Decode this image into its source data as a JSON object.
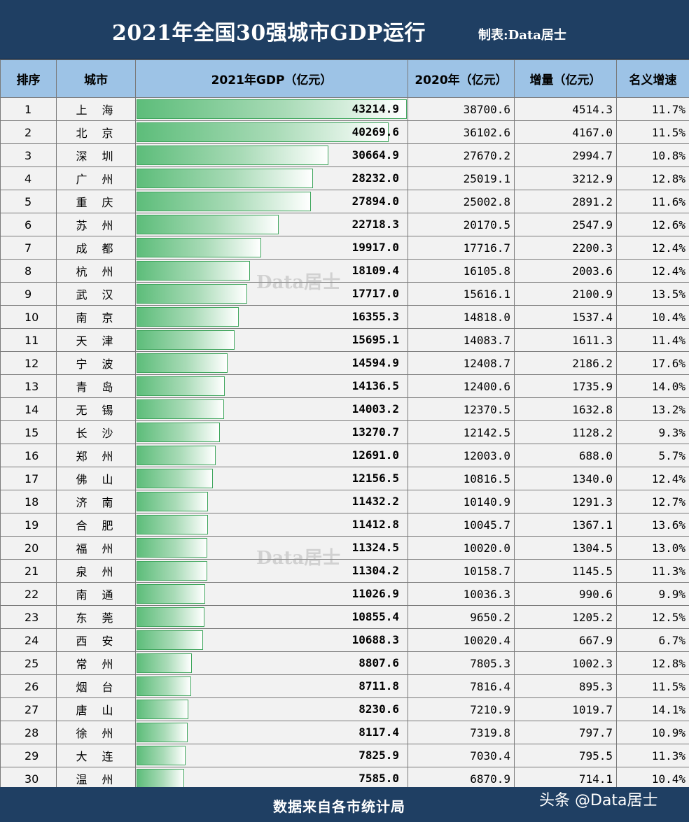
{
  "header": {
    "title": "2021年全国30强城市GDP运行",
    "subtitle": "制表:Data居士"
  },
  "columns": [
    "排序",
    "城市",
    "2021年GDP（亿元）",
    "2020年（亿元）",
    "增量（亿元）",
    "名义增速"
  ],
  "chart_data": {
    "type": "table",
    "title": "2021年全国30强城市GDP运行",
    "bar_max": 43214.9,
    "rows": [
      {
        "rank": "1",
        "city": "上 海",
        "gdp2021": "43214.9",
        "gdp2020": "38700.6",
        "increase": "4514.3",
        "growth": "11.7%"
      },
      {
        "rank": "2",
        "city": "北 京",
        "gdp2021": "40269.6",
        "gdp2020": "36102.6",
        "increase": "4167.0",
        "growth": "11.5%"
      },
      {
        "rank": "3",
        "city": "深 圳",
        "gdp2021": "30664.9",
        "gdp2020": "27670.2",
        "increase": "2994.7",
        "growth": "10.8%"
      },
      {
        "rank": "4",
        "city": "广 州",
        "gdp2021": "28232.0",
        "gdp2020": "25019.1",
        "increase": "3212.9",
        "growth": "12.8%"
      },
      {
        "rank": "5",
        "city": "重 庆",
        "gdp2021": "27894.0",
        "gdp2020": "25002.8",
        "increase": "2891.2",
        "growth": "11.6%"
      },
      {
        "rank": "6",
        "city": "苏 州",
        "gdp2021": "22718.3",
        "gdp2020": "20170.5",
        "increase": "2547.9",
        "growth": "12.6%"
      },
      {
        "rank": "7",
        "city": "成 都",
        "gdp2021": "19917.0",
        "gdp2020": "17716.7",
        "increase": "2200.3",
        "growth": "12.4%"
      },
      {
        "rank": "8",
        "city": "杭 州",
        "gdp2021": "18109.4",
        "gdp2020": "16105.8",
        "increase": "2003.6",
        "growth": "12.4%"
      },
      {
        "rank": "9",
        "city": "武 汉",
        "gdp2021": "17717.0",
        "gdp2020": "15616.1",
        "increase": "2100.9",
        "growth": "13.5%"
      },
      {
        "rank": "10",
        "city": "南 京",
        "gdp2021": "16355.3",
        "gdp2020": "14818.0",
        "increase": "1537.4",
        "growth": "10.4%"
      },
      {
        "rank": "11",
        "city": "天 津",
        "gdp2021": "15695.1",
        "gdp2020": "14083.7",
        "increase": "1611.3",
        "growth": "11.4%"
      },
      {
        "rank": "12",
        "city": "宁 波",
        "gdp2021": "14594.9",
        "gdp2020": "12408.7",
        "increase": "2186.2",
        "growth": "17.6%"
      },
      {
        "rank": "13",
        "city": "青 岛",
        "gdp2021": "14136.5",
        "gdp2020": "12400.6",
        "increase": "1735.9",
        "growth": "14.0%"
      },
      {
        "rank": "14",
        "city": "无 锡",
        "gdp2021": "14003.2",
        "gdp2020": "12370.5",
        "increase": "1632.8",
        "growth": "13.2%"
      },
      {
        "rank": "15",
        "city": "长 沙",
        "gdp2021": "13270.7",
        "gdp2020": "12142.5",
        "increase": "1128.2",
        "growth": "9.3%"
      },
      {
        "rank": "16",
        "city": "郑 州",
        "gdp2021": "12691.0",
        "gdp2020": "12003.0",
        "increase": "688.0",
        "growth": "5.7%"
      },
      {
        "rank": "17",
        "city": "佛 山",
        "gdp2021": "12156.5",
        "gdp2020": "10816.5",
        "increase": "1340.0",
        "growth": "12.4%"
      },
      {
        "rank": "18",
        "city": "济 南",
        "gdp2021": "11432.2",
        "gdp2020": "10140.9",
        "increase": "1291.3",
        "growth": "12.7%"
      },
      {
        "rank": "19",
        "city": "合 肥",
        "gdp2021": "11412.8",
        "gdp2020": "10045.7",
        "increase": "1367.1",
        "growth": "13.6%"
      },
      {
        "rank": "20",
        "city": "福 州",
        "gdp2021": "11324.5",
        "gdp2020": "10020.0",
        "increase": "1304.5",
        "growth": "13.0%"
      },
      {
        "rank": "21",
        "city": "泉 州",
        "gdp2021": "11304.2",
        "gdp2020": "10158.7",
        "increase": "1145.5",
        "growth": "11.3%"
      },
      {
        "rank": "22",
        "city": "南 通",
        "gdp2021": "11026.9",
        "gdp2020": "10036.3",
        "increase": "990.6",
        "growth": "9.9%"
      },
      {
        "rank": "23",
        "city": "东 莞",
        "gdp2021": "10855.4",
        "gdp2020": "9650.2",
        "increase": "1205.2",
        "growth": "12.5%"
      },
      {
        "rank": "24",
        "city": "西 安",
        "gdp2021": "10688.3",
        "gdp2020": "10020.4",
        "increase": "667.9",
        "growth": "6.7%"
      },
      {
        "rank": "25",
        "city": "常 州",
        "gdp2021": "8807.6",
        "gdp2020": "7805.3",
        "increase": "1002.3",
        "growth": "12.8%"
      },
      {
        "rank": "26",
        "city": "烟 台",
        "gdp2021": "8711.8",
        "gdp2020": "7816.4",
        "increase": "895.3",
        "growth": "11.5%"
      },
      {
        "rank": "27",
        "city": "唐 山",
        "gdp2021": "8230.6",
        "gdp2020": "7210.9",
        "increase": "1019.7",
        "growth": "14.1%"
      },
      {
        "rank": "28",
        "city": "徐 州",
        "gdp2021": "8117.4",
        "gdp2020": "7319.8",
        "increase": "797.7",
        "growth": "10.9%"
      },
      {
        "rank": "29",
        "city": "大 连",
        "gdp2021": "7825.9",
        "gdp2020": "7030.4",
        "increase": "795.5",
        "growth": "11.3%"
      },
      {
        "rank": "30",
        "city": "温 州",
        "gdp2021": "7585.0",
        "gdp2020": "6870.9",
        "increase": "714.1",
        "growth": "10.4%"
      }
    ]
  },
  "footer": {
    "source": "数据来自各市统计局",
    "credit": "头条 @Data居士"
  },
  "watermark": "Data居士",
  "colors": {
    "header_bg": "#1f3f63",
    "column_header_bg": "#9dc3e6",
    "bar_green": "#5dbd7a"
  }
}
